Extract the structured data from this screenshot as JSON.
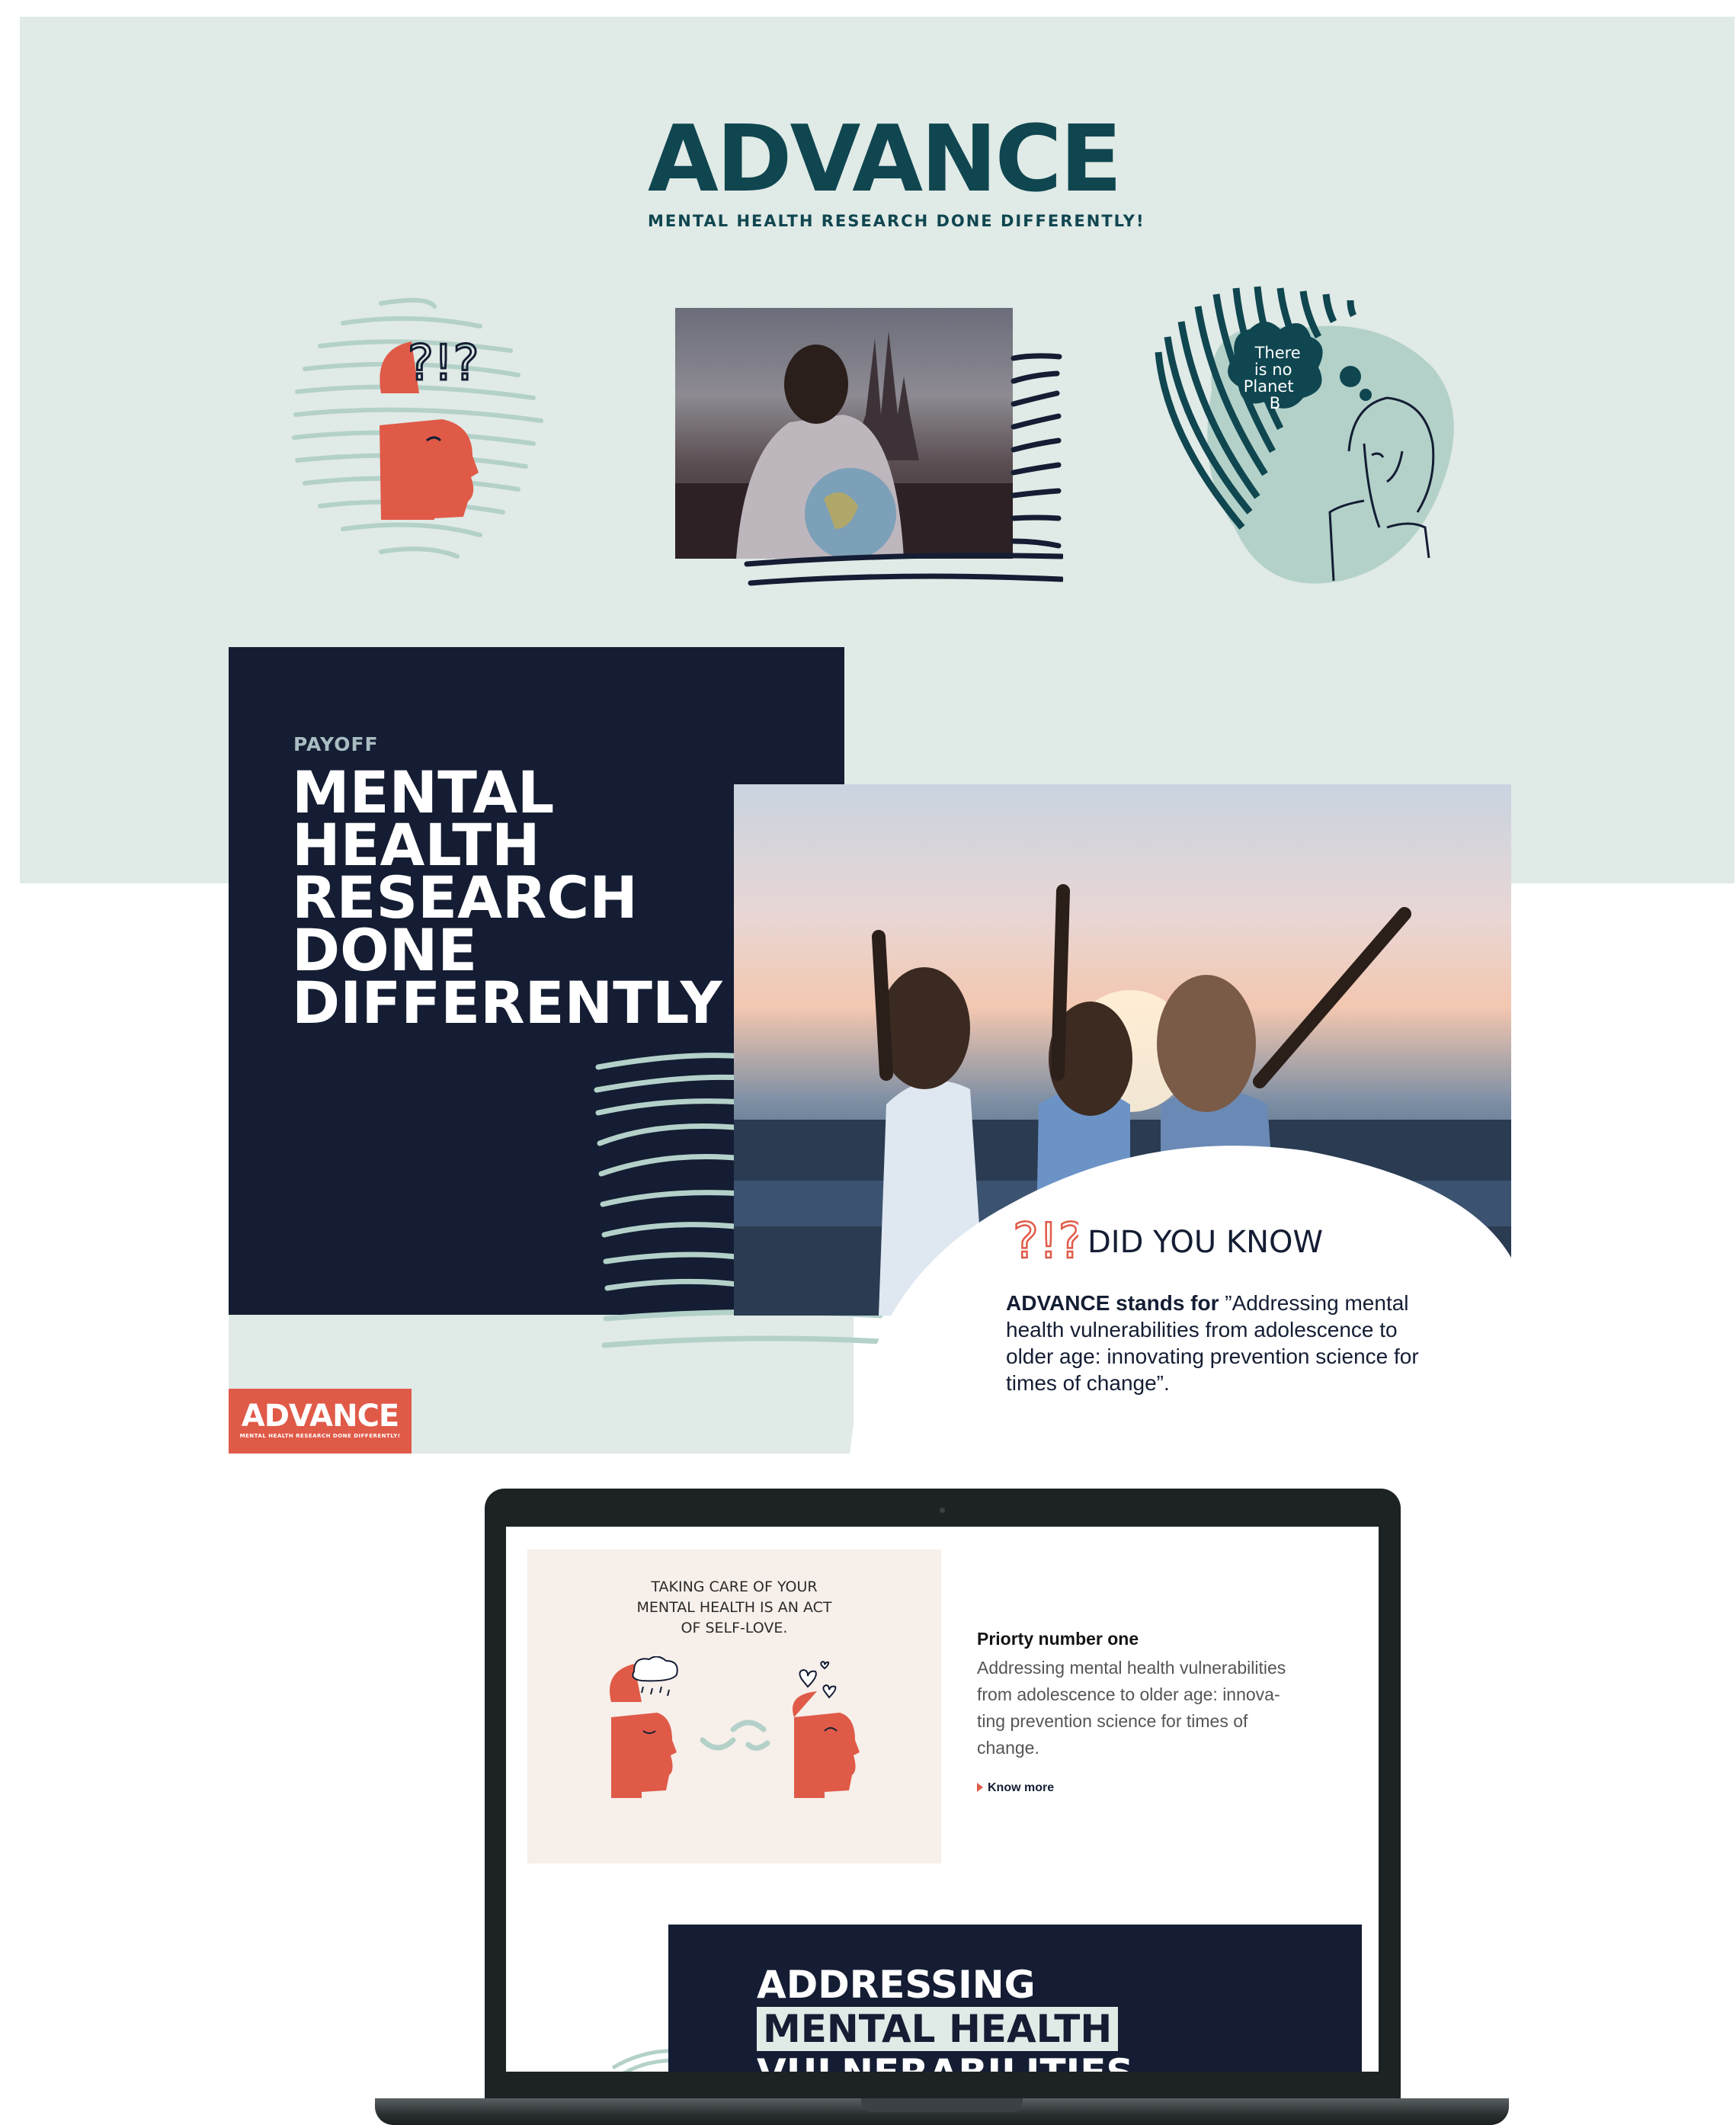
{
  "brand": {
    "name": "ADVANCE",
    "tagline": "MENTAL HEALTH RESEARCH DONE DIFFERENTLY!",
    "small_tagline": "MENTAL HEALTH RESEARCH DONE DIFFERENTLY!"
  },
  "illustrations": {
    "bubble_text": [
      "There",
      "is no",
      "Planet",
      "B"
    ]
  },
  "payoff": {
    "label": "PAYOFF",
    "title_lines": [
      "MENTAL",
      "HEALTH",
      "RESEARCH",
      "DONE",
      "DIFFERENTLY"
    ]
  },
  "did_you_know": {
    "title": "DID YOU KNOW",
    "bold": "ADVANCE stands for",
    "text": " ”Addressing mental health vulnerabilities from adolescence to older age: innovating prevention science for times of change”."
  },
  "laptop_screen": {
    "caption_lines": [
      "TAKING CARE OF YOUR",
      "MENTAL HEALTH IS AN ACT",
      "OF SELF-LOVE."
    ],
    "priority_title": "Priorty number one",
    "priority_lines": [
      "Addressing mental health vulnerabilities",
      "from adolescence to older age: innova-",
      "ting prevention science for times of",
      "change."
    ],
    "link": "Know more",
    "banner_lines": [
      "ADDRESSING",
      "MENTAL HEALTH",
      "VULNERABILITIES"
    ]
  },
  "colors": {
    "mint": "#e0eae6",
    "navy": "#141d33",
    "teal": "#0f4650",
    "coral": "#e05a48",
    "sage": "#b3d1c9"
  }
}
